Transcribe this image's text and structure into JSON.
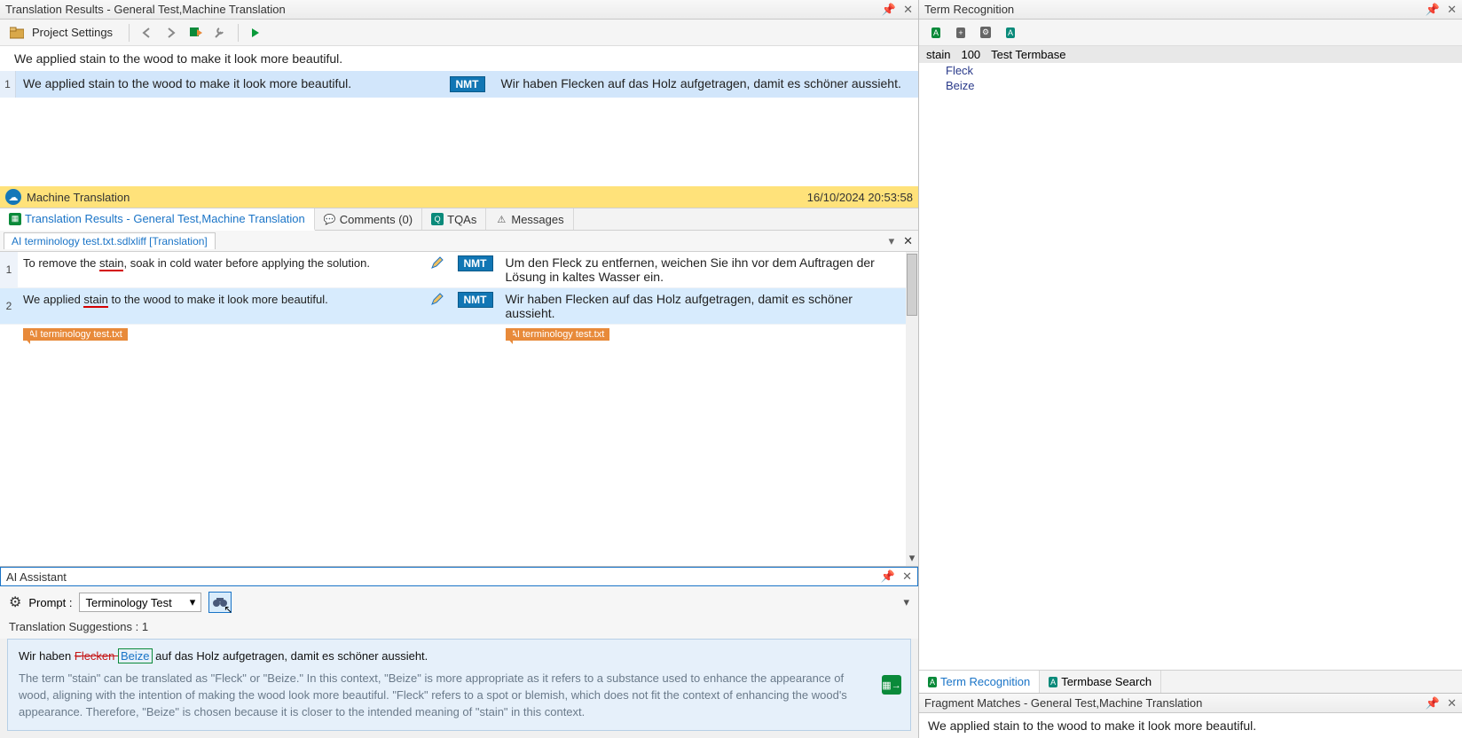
{
  "translationResults": {
    "title": "Translation Results - General Test,Machine Translation",
    "toolbar": {
      "projectSettings": "Project Settings"
    },
    "sourceSentence": "We applied stain to the wood to make it look more beautiful.",
    "row": {
      "index": "1",
      "src": "We applied stain to the wood to make it look more beautiful.",
      "badge": "NMT",
      "tgt": "Wir haben Flecken auf das Holz aufgetragen, damit es schöner aussieht."
    },
    "mtBar": {
      "label": "Machine Translation",
      "timestamp": "16/10/2024 20:53:58"
    },
    "tabs": {
      "results": "Translation Results - General Test,Machine Translation",
      "comments": "Comments (0)",
      "tqas": "TQAs",
      "messages": "Messages"
    }
  },
  "docTab": "AI terminology test.txt.sdlxliff [Translation]",
  "editor": {
    "rows": [
      {
        "idx": "1",
        "src_a": "To remove the ",
        "src_u": "stain",
        "src_b": ", soak in cold water before applying the solution.",
        "badge": "NMT",
        "tgt": "Um den Fleck zu entfernen, weichen Sie ihn vor dem Auftragen der Lösung in kaltes Wasser ein."
      },
      {
        "idx": "2",
        "src_a": "We applied ",
        "src_u": "stain",
        "src_b": " to the wood to make it look more beautiful.",
        "badge": "NMT",
        "tgt": "Wir haben Flecken auf das Holz aufgetragen, damit es schöner aussieht."
      }
    ],
    "fileTag": "AI terminology test.txt"
  },
  "aiAssistant": {
    "title": "AI Assistant",
    "promptLabel": "Prompt :",
    "promptValue": "Terminology Test",
    "suggestionsLabel": "Translation Suggestions : 1",
    "suggestion": {
      "prefix": "Wir haben ",
      "strike": "Flecken ",
      "replace": "Beize",
      "suffix": " auf das Holz aufgetragen, damit es schöner aussieht.",
      "explanation": "The term \"stain\" can be translated as \"Fleck\" or \"Beize.\" In this context, \"Beize\" is more appropriate as it refers to a substance used to enhance the appearance of wood, aligning with the intention of making the wood look more beautiful. \"Fleck\" refers to a spot or blemish, which does not fit the context of enhancing the wood's appearance. Therefore, \"Beize\" is chosen because it is closer to the intended meaning of \"stain\" in this context."
    }
  },
  "termRecognition": {
    "title": "Term Recognition",
    "entry": {
      "word": "stain",
      "score": "100",
      "tb": "Test Termbase"
    },
    "targets": [
      "Fleck",
      "Beize"
    ],
    "bottomTabs": {
      "rec": "Term Recognition",
      "search": "Termbase Search"
    }
  },
  "fragmentMatches": {
    "title": "Fragment Matches - General Test,Machine Translation",
    "text": "We applied stain to the wood to make it look more beautiful."
  }
}
